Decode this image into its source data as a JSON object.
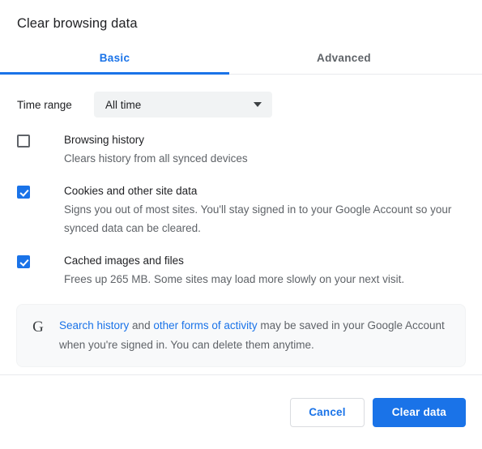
{
  "dialog": {
    "title": "Clear browsing data"
  },
  "tabs": [
    {
      "label": "Basic",
      "active": true
    },
    {
      "label": "Advanced",
      "active": false
    }
  ],
  "time_range": {
    "label": "Time range",
    "selected": "All time",
    "caret_icon": "chevron-down-icon"
  },
  "options": [
    {
      "title": "Browsing history",
      "description": "Clears history from all synced devices",
      "checked": false
    },
    {
      "title": "Cookies and other site data",
      "description": "Signs you out of most sites. You'll stay signed in to your Google Account so your synced data can be cleared.",
      "checked": true
    },
    {
      "title": "Cached images and files",
      "description": "Frees up 265 MB. Some sites may load more slowly on your next visit.",
      "checked": true
    }
  ],
  "info_card": {
    "logo": "G",
    "link1": "Search history",
    "mid_text": " and ",
    "link2": "other forms of activity",
    "tail_text": " may be saved in your Google Account when you're signed in. You can delete them anytime."
  },
  "footer": {
    "cancel_label": "Cancel",
    "confirm_label": "Clear data"
  },
  "colors": {
    "accent": "#1a73e8",
    "text_primary": "#202124",
    "text_secondary": "#5f6368",
    "card_bg": "#f8f9fa",
    "select_bg": "#f1f3f4",
    "divider": "#e8eaed"
  }
}
